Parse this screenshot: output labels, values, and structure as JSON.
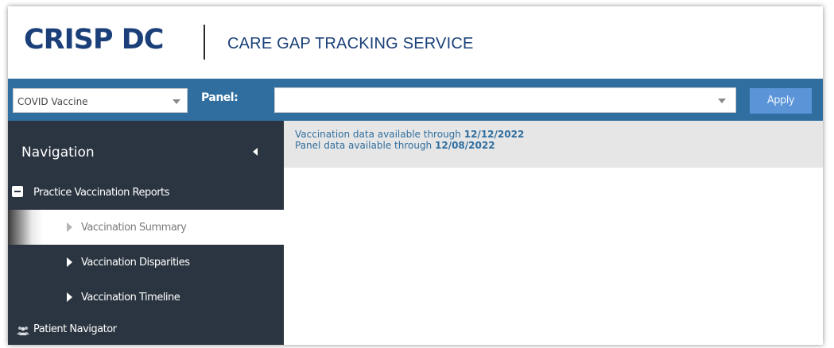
{
  "header": {
    "logo_text": "CRISP DC",
    "service_title": "CARE GAP TRACKING SERVICE"
  },
  "toolbar": {
    "vaccine_select_value": "COVID Vaccine",
    "panel_label": "Panel:",
    "panel_select_value": "",
    "apply_label": "Apply"
  },
  "sidebar": {
    "title": "Navigation",
    "group": {
      "label": "Practice Vaccination Reports",
      "items": [
        {
          "label": "Vaccination Summary",
          "active": true
        },
        {
          "label": "Vaccination Disparities",
          "active": false
        },
        {
          "label": "Vaccination Timeline",
          "active": false
        }
      ]
    },
    "patient_navigator_label": "Patient Navigator"
  },
  "main": {
    "vaccination_prefix": "Vaccination data available through",
    "vaccination_date": "12/12/2022",
    "panel_prefix": "Panel data available through",
    "panel_date": "12/08/2022"
  },
  "icons": {
    "collapse": "caret-left-icon",
    "group_toggle": "minus-square-icon",
    "item_arrow": "caret-right-icon",
    "dropdown": "caret-down-icon",
    "patient": "people-icon"
  },
  "colors": {
    "brand_navy": "#1b4079",
    "toolbar_blue": "#2f6e9f",
    "apply_button": "#5b95d8",
    "sidebar_bg": "#2b3541",
    "banner_bg": "#e6e6e6"
  }
}
